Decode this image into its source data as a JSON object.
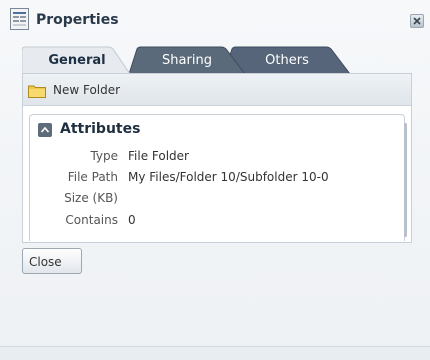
{
  "dialog": {
    "title": "Properties",
    "icons": {
      "title": "properties-icon",
      "close": "close-icon"
    }
  },
  "tabs": [
    {
      "label": "General",
      "active": true
    },
    {
      "label": "Sharing",
      "active": false
    },
    {
      "label": "Others",
      "active": false
    }
  ],
  "folder": {
    "name": "New Folder",
    "icon": "folder-icon"
  },
  "attributes": {
    "title": "Attributes",
    "rows": [
      {
        "label": "Type",
        "value": "File Folder"
      },
      {
        "label": "File Path",
        "value": "My Files/Folder 10/Subfolder 10-0"
      },
      {
        "label": "Size (KB)",
        "value": ""
      },
      {
        "label": "Contains",
        "value": "0"
      }
    ]
  },
  "buttons": {
    "close": "Close"
  },
  "colors": {
    "active_tab_bg": "#e7ebef",
    "inactive_tab_bg": "#5b6a7a",
    "panel_border": "#c7d0d8",
    "folder_yellow": "#f0c84a"
  }
}
